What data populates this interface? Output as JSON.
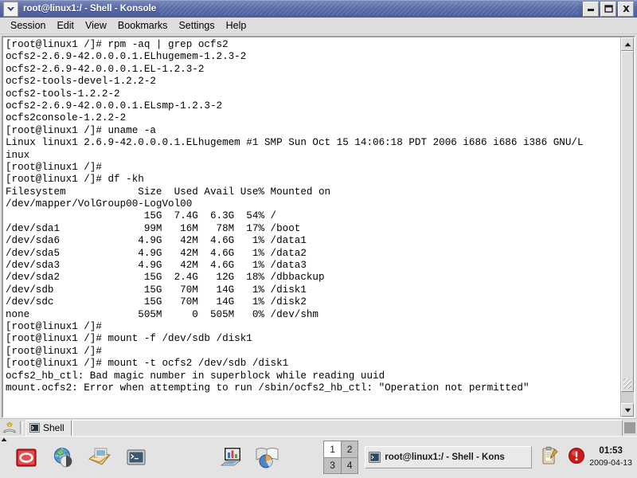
{
  "window": {
    "title": "root@linux1:/ - Shell - Konsole",
    "menu_icon": "chevron-down-icon",
    "buttons": {
      "minimize": "minimize-icon",
      "maximize": "maximize-icon",
      "close": "close-icon"
    }
  },
  "menubar": {
    "items": [
      {
        "label": "Session"
      },
      {
        "label": "Edit"
      },
      {
        "label": "View"
      },
      {
        "label": "Bookmarks"
      },
      {
        "label": "Settings"
      },
      {
        "label": "Help"
      }
    ]
  },
  "terminal": {
    "lines": [
      "[root@linux1 /]# rpm -aq | grep ocfs2",
      "ocfs2-2.6.9-42.0.0.0.1.ELhugemem-1.2.3-2",
      "ocfs2-2.6.9-42.0.0.0.1.EL-1.2.3-2",
      "ocfs2-tools-devel-1.2.2-2",
      "ocfs2-tools-1.2.2-2",
      "ocfs2-2.6.9-42.0.0.0.1.ELsmp-1.2.3-2",
      "ocfs2console-1.2.2-2",
      "[root@linux1 /]# uname -a",
      "Linux linux1 2.6.9-42.0.0.0.1.ELhugemem #1 SMP Sun Oct 15 14:06:18 PDT 2006 i686 i686 i386 GNU/L",
      "inux",
      "[root@linux1 /]#",
      "[root@linux1 /]# df -kh",
      "Filesystem            Size  Used Avail Use% Mounted on",
      "/dev/mapper/VolGroup00-LogVol00",
      "                       15G  7.4G  6.3G  54% /",
      "/dev/sda1              99M   16M   78M  17% /boot",
      "/dev/sda6             4.9G   42M  4.6G   1% /data1",
      "/dev/sda5             4.9G   42M  4.6G   1% /data2",
      "/dev/sda3             4.9G   42M  4.6G   1% /data3",
      "/dev/sda2              15G  2.4G   12G  18% /dbbackup",
      "/dev/sdb               15G   70M   14G   1% /disk1",
      "/dev/sdc               15G   70M   14G   1% /disk2",
      "none                  505M     0  505M   0% /dev/shm",
      "[root@linux1 /]#",
      "[root@linux1 /]# mount -f /dev/sdb /disk1",
      "[root@linux1 /]#",
      "[root@linux1 /]# mount -t ocfs2 /dev/sdb /disk1",
      "ocfs2_hb_ctl: Bad magic number in superblock while reading uuid",
      "mount.ocfs2: Error when attempting to run /sbin/ocfs2_hb_ctl: \"Operation not permitted\""
    ],
    "background": "#ffffff",
    "foreground": "#000000"
  },
  "scrollbar": {
    "up_icon": "arrow-up-icon",
    "down_icon": "arrow-down-icon"
  },
  "tabbar": {
    "new_session_icon": "new-session-icon",
    "tabs": [
      {
        "label": "Shell",
        "icon": "terminal-icon",
        "active": true
      }
    ]
  },
  "panel": {
    "launchers": [
      {
        "name": "oracle-launcher",
        "icon": "oracle-icon"
      },
      {
        "name": "browser-launcher",
        "icon": "globe-icon"
      },
      {
        "name": "mail-launcher",
        "icon": "mail-icon"
      },
      {
        "name": "terminal-launcher",
        "icon": "terminal-icon"
      },
      {
        "name": "spreadsheet-launcher",
        "icon": "chart-icon"
      },
      {
        "name": "presentation-launcher",
        "icon": "presentation-icon"
      }
    ],
    "pager": {
      "desktops": [
        {
          "label": "1",
          "active": true
        },
        {
          "label": "2",
          "active": false
        },
        {
          "label": "3",
          "active": false
        },
        {
          "label": "4",
          "active": false
        }
      ]
    },
    "tasks": [
      {
        "label": "root@linux1:/ - Shell - Kons",
        "icon": "terminal-icon"
      }
    ],
    "systray": [
      {
        "name": "klipper-icon",
        "icon": "clipboard-icon"
      },
      {
        "name": "alert-icon",
        "icon": "alert-icon"
      }
    ],
    "clock": {
      "time": "01:53",
      "date": "2009-04-13"
    }
  },
  "colors": {
    "titlebar": "#4a5c9c",
    "panel": "#e3e3e3",
    "window_chrome": "#dedede",
    "terminal_bg": "#ffffff",
    "accent_red": "#cc1a1a"
  }
}
